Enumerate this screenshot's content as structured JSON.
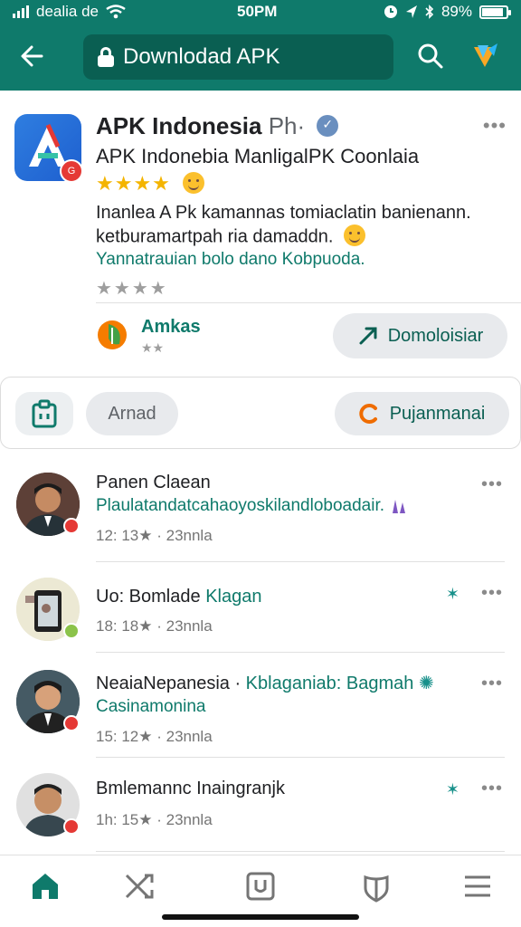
{
  "status_bar": {
    "carrier": "dealia de",
    "time": "50PM",
    "battery": "89%",
    "battery_level": 0.89
  },
  "header": {
    "back_icon": "arrow-left-icon",
    "search_box": "Downlodad APK",
    "lock_icon": "lock-icon",
    "search_icon": "search-icon",
    "logo_icon": "app-logo-icon"
  },
  "app": {
    "title": "APK Indonesia",
    "title_suffix": "Ph·",
    "subtitle": "APK Indonebia ManligalPK Coonlaia",
    "rating_stars": "★★★★",
    "rating_value": 4,
    "desc_line1": "Inanlea A Pk kamannas tomiaclatin banienann.",
    "desc_line2": "ketburamartpah ria damaddn.",
    "desc_line3": "Yannatrauian bolo dano Kobpuoda.",
    "grey_stars": "★★★★",
    "developer_name": "Amkas",
    "developer_stars": "★★",
    "download_label": "Domoloisiar",
    "accent_color": "#0f7a6b",
    "header_color": "#0f7a6b"
  },
  "actions": {
    "left_icon": "clipboard-icon",
    "pill_label": "Arnad",
    "right_label": "Pujanmanai"
  },
  "reviews": [
    {
      "name": "Panen Claean",
      "name_accent": "",
      "line": "Plaulatandatcahaoyoskilandloboadair.",
      "meta": "12: 13★ · 23nnla",
      "dot_color": "#e53935"
    },
    {
      "name": "Uo: Bomlade",
      "name_accent": "Klagan",
      "line": "",
      "meta": "18: 18★ · 23nnla",
      "dot_color": "#8bc34a"
    },
    {
      "name": "NeaiaNepanesia ·",
      "name_accent": "Kblaganiab: Bagmah",
      "line": "Casinamonina",
      "meta": "15: 12★ · 23nnla",
      "dot_color": "#e53935"
    },
    {
      "name": "Bmlemannc Inaingranjk",
      "name_accent": "",
      "line": "",
      "meta": "1h: 15★ · 23nnla",
      "dot_color": "#e53935"
    }
  ],
  "bottom_nav": [
    {
      "icon": "home-icon",
      "active": true
    },
    {
      "icon": "shuffle-icon",
      "active": false
    },
    {
      "icon": "library-icon",
      "active": false
    },
    {
      "icon": "shield-icon",
      "active": false
    },
    {
      "icon": "menu-icon",
      "active": false
    }
  ]
}
